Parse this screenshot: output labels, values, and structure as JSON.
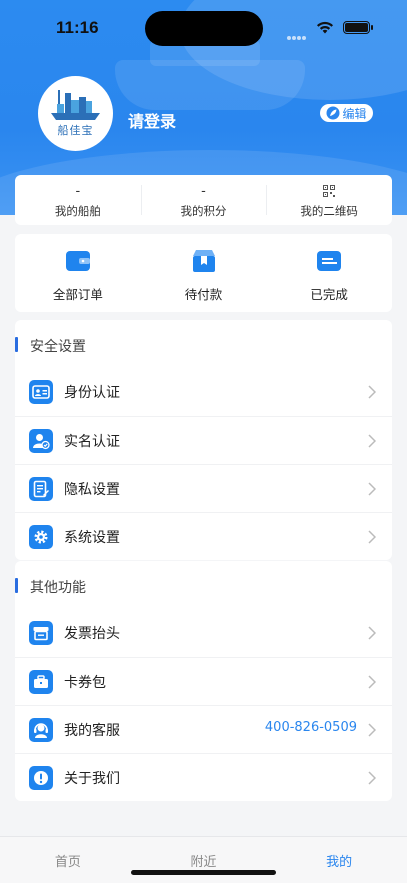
{
  "status_bar": {
    "time": "11:16"
  },
  "profile": {
    "brand_text": "船佳宝",
    "login_text": "请登录",
    "edit_label": "编辑"
  },
  "stats": [
    {
      "value": "-",
      "label": "我的船舶"
    },
    {
      "value": "-",
      "label": "我的积分"
    },
    {
      "value": "",
      "label": "我的二维码",
      "icon": "qr-code-icon"
    }
  ],
  "orders": [
    {
      "label": "全部订单",
      "icon": "wallet-icon"
    },
    {
      "label": "待付款",
      "icon": "box-icon"
    },
    {
      "label": "已完成",
      "icon": "card-icon"
    }
  ],
  "security": {
    "title": "安全设置",
    "items": [
      {
        "label": "身份认证",
        "icon": "id-card-icon"
      },
      {
        "label": "实名认证",
        "icon": "user-check-icon"
      },
      {
        "label": "隐私设置",
        "icon": "document-edit-icon"
      },
      {
        "label": "系统设置",
        "icon": "gear-icon"
      }
    ]
  },
  "other": {
    "title": "其他功能",
    "items": [
      {
        "label": "发票抬头",
        "icon": "printer-icon",
        "value": ""
      },
      {
        "label": "卡券包",
        "icon": "briefcase-icon",
        "value": ""
      },
      {
        "label": "我的客服",
        "icon": "headset-icon",
        "value": "400-826-0509"
      },
      {
        "label": "关于我们",
        "icon": "info-icon",
        "value": ""
      }
    ]
  },
  "tabbar": {
    "items": [
      {
        "label": "首页"
      },
      {
        "label": "附近"
      },
      {
        "label": "我的"
      }
    ],
    "active_index": 2
  },
  "colors": {
    "accent": "#2a86ee",
    "icon_bg": "#1f84ee",
    "section_bar": "#2a6de0"
  }
}
